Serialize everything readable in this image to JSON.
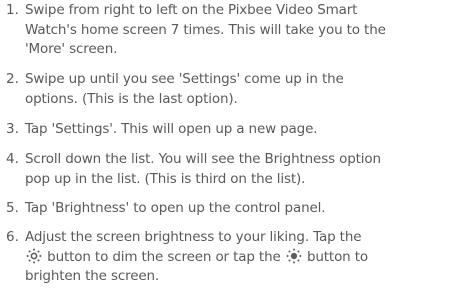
{
  "steps": [
    {
      "num": "1.",
      "lines": [
        "Swipe from right to left on the Pixbee Video Smart",
        "Watch's home screen 7 times. This will take you to the",
        "'More' screen."
      ]
    },
    {
      "num": "2.",
      "lines": [
        "Swipe up until you see 'Settings' come up in the",
        "options. (This is the last option)."
      ]
    },
    {
      "num": "3.",
      "lines": [
        "Tap 'Settings'. This will open up a new page."
      ]
    },
    {
      "num": "4.",
      "lines": [
        "Scroll down the list. You will see the Brightness option",
        "pop up in the list. (This is third on the list)."
      ]
    },
    {
      "num": "5.",
      "lines": [
        "Tap 'Brightness' to open up the control panel."
      ]
    },
    {
      "num": "6.",
      "line1": "Adjust the screen brightness to your liking. Tap the",
      "line2_before": "button to dim the screen or tap the",
      "line2_after": "button to",
      "line3": "brighten the screen.",
      "dim_icon": "sun-outline-icon",
      "bright_icon": "sun-filled-icon"
    }
  ]
}
